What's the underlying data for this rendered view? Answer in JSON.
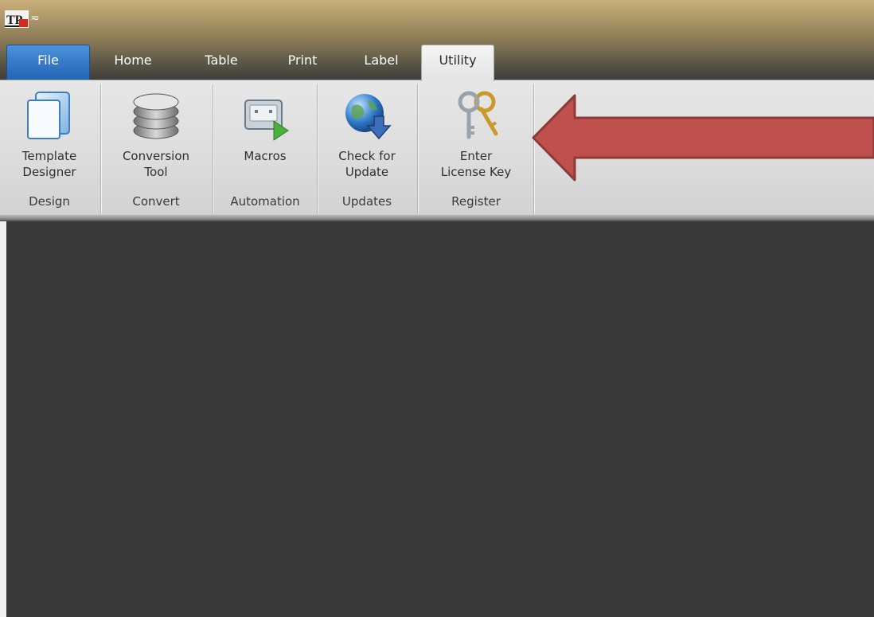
{
  "app": {
    "logo_text": "TP"
  },
  "quick_access": {
    "dropdown_glyph": "≂"
  },
  "tabs": [
    {
      "label": "File"
    },
    {
      "label": "Home"
    },
    {
      "label": "Table"
    },
    {
      "label": "Print"
    },
    {
      "label": "Label"
    },
    {
      "label": "Utility"
    }
  ],
  "ribbon": {
    "groups": [
      {
        "name": "Design",
        "command": {
          "label": "Template\nDesigner",
          "icon": "template-designer-icon"
        }
      },
      {
        "name": "Convert",
        "command": {
          "label": "Conversion\nTool",
          "icon": "database-icon"
        }
      },
      {
        "name": "Automation",
        "command": {
          "label": "Macros",
          "icon": "macro-play-icon"
        }
      },
      {
        "name": "Updates",
        "command": {
          "label": "Check for\nUpdate",
          "icon": "globe-download-icon"
        }
      },
      {
        "name": "Register",
        "command": {
          "label": "Enter\nLicense Key",
          "icon": "keys-icon"
        }
      }
    ]
  },
  "annotation": {
    "type": "arrow",
    "color": "#c0504d"
  },
  "colors": {
    "file_tab": "#2f76c9",
    "ribbon_bg": "#e0e0e0",
    "workspace": "#383838",
    "title_bar": "#b59d6b"
  }
}
